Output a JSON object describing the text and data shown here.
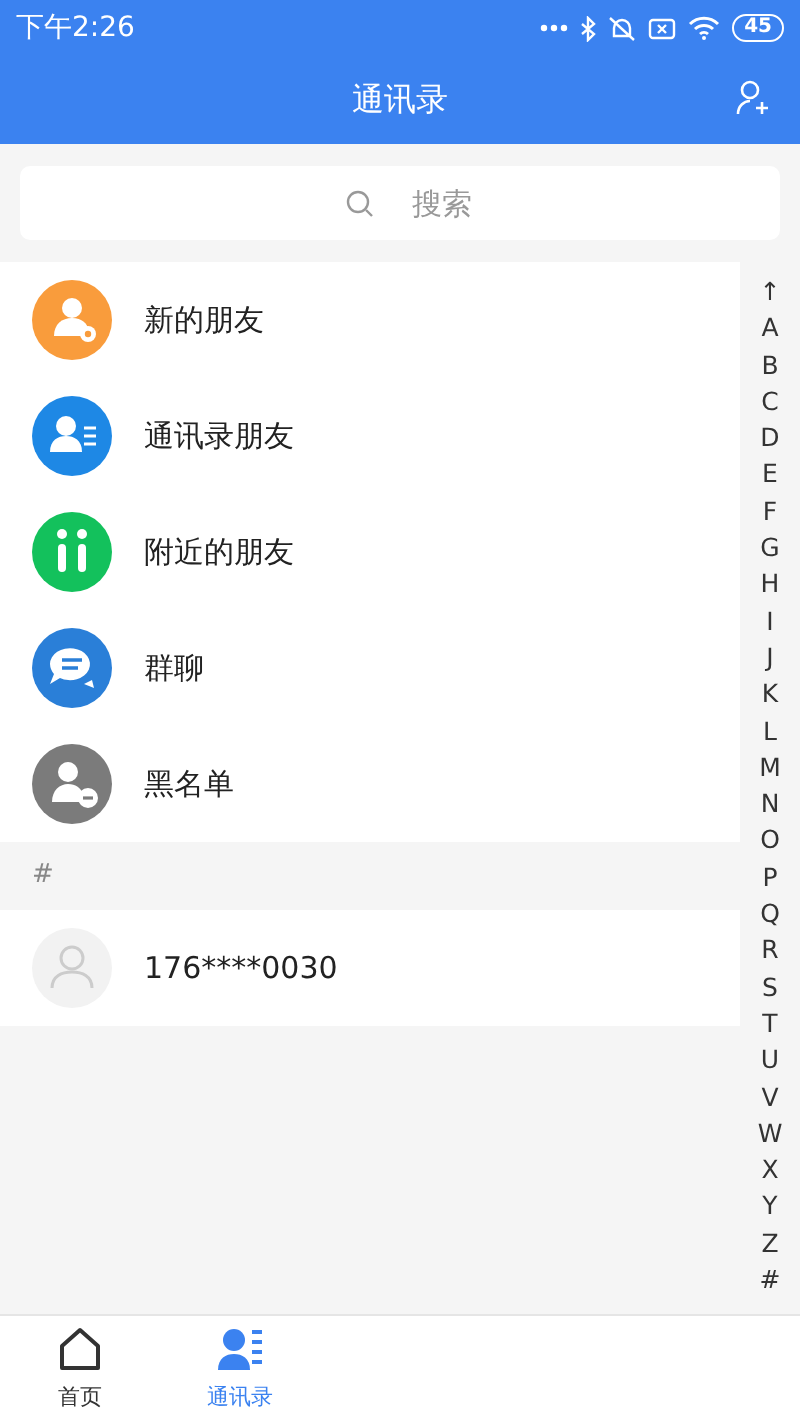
{
  "status_bar": {
    "time": "下午2:26",
    "battery": "45"
  },
  "header": {
    "title": "通讯录"
  },
  "search": {
    "placeholder": "搜索"
  },
  "shortcuts": [
    {
      "kind": "new",
      "label": "新的朋友",
      "color": "#f99c3c"
    },
    {
      "kind": "contacts",
      "label": "通讯录朋友",
      "color": "#1e88e5"
    },
    {
      "kind": "nearby",
      "label": "附近的朋友",
      "color": "#13c15c"
    },
    {
      "kind": "group",
      "label": "群聊",
      "color": "#2a7fd8"
    },
    {
      "kind": "blocked",
      "label": "黑名单",
      "color": "#7b7b7b"
    }
  ],
  "sections": [
    {
      "header": "#",
      "contacts": [
        {
          "name": "176****0030"
        }
      ]
    }
  ],
  "index_bar": [
    "↑",
    "A",
    "B",
    "C",
    "D",
    "E",
    "F",
    "G",
    "H",
    "I",
    "J",
    "K",
    "L",
    "M",
    "N",
    "O",
    "P",
    "Q",
    "R",
    "S",
    "T",
    "U",
    "V",
    "W",
    "X",
    "Y",
    "Z",
    "#"
  ],
  "tab_bar": [
    {
      "kind": "home",
      "label": "首页",
      "selected": false
    },
    {
      "kind": "contacts",
      "label": "通讯录",
      "selected": true
    }
  ]
}
